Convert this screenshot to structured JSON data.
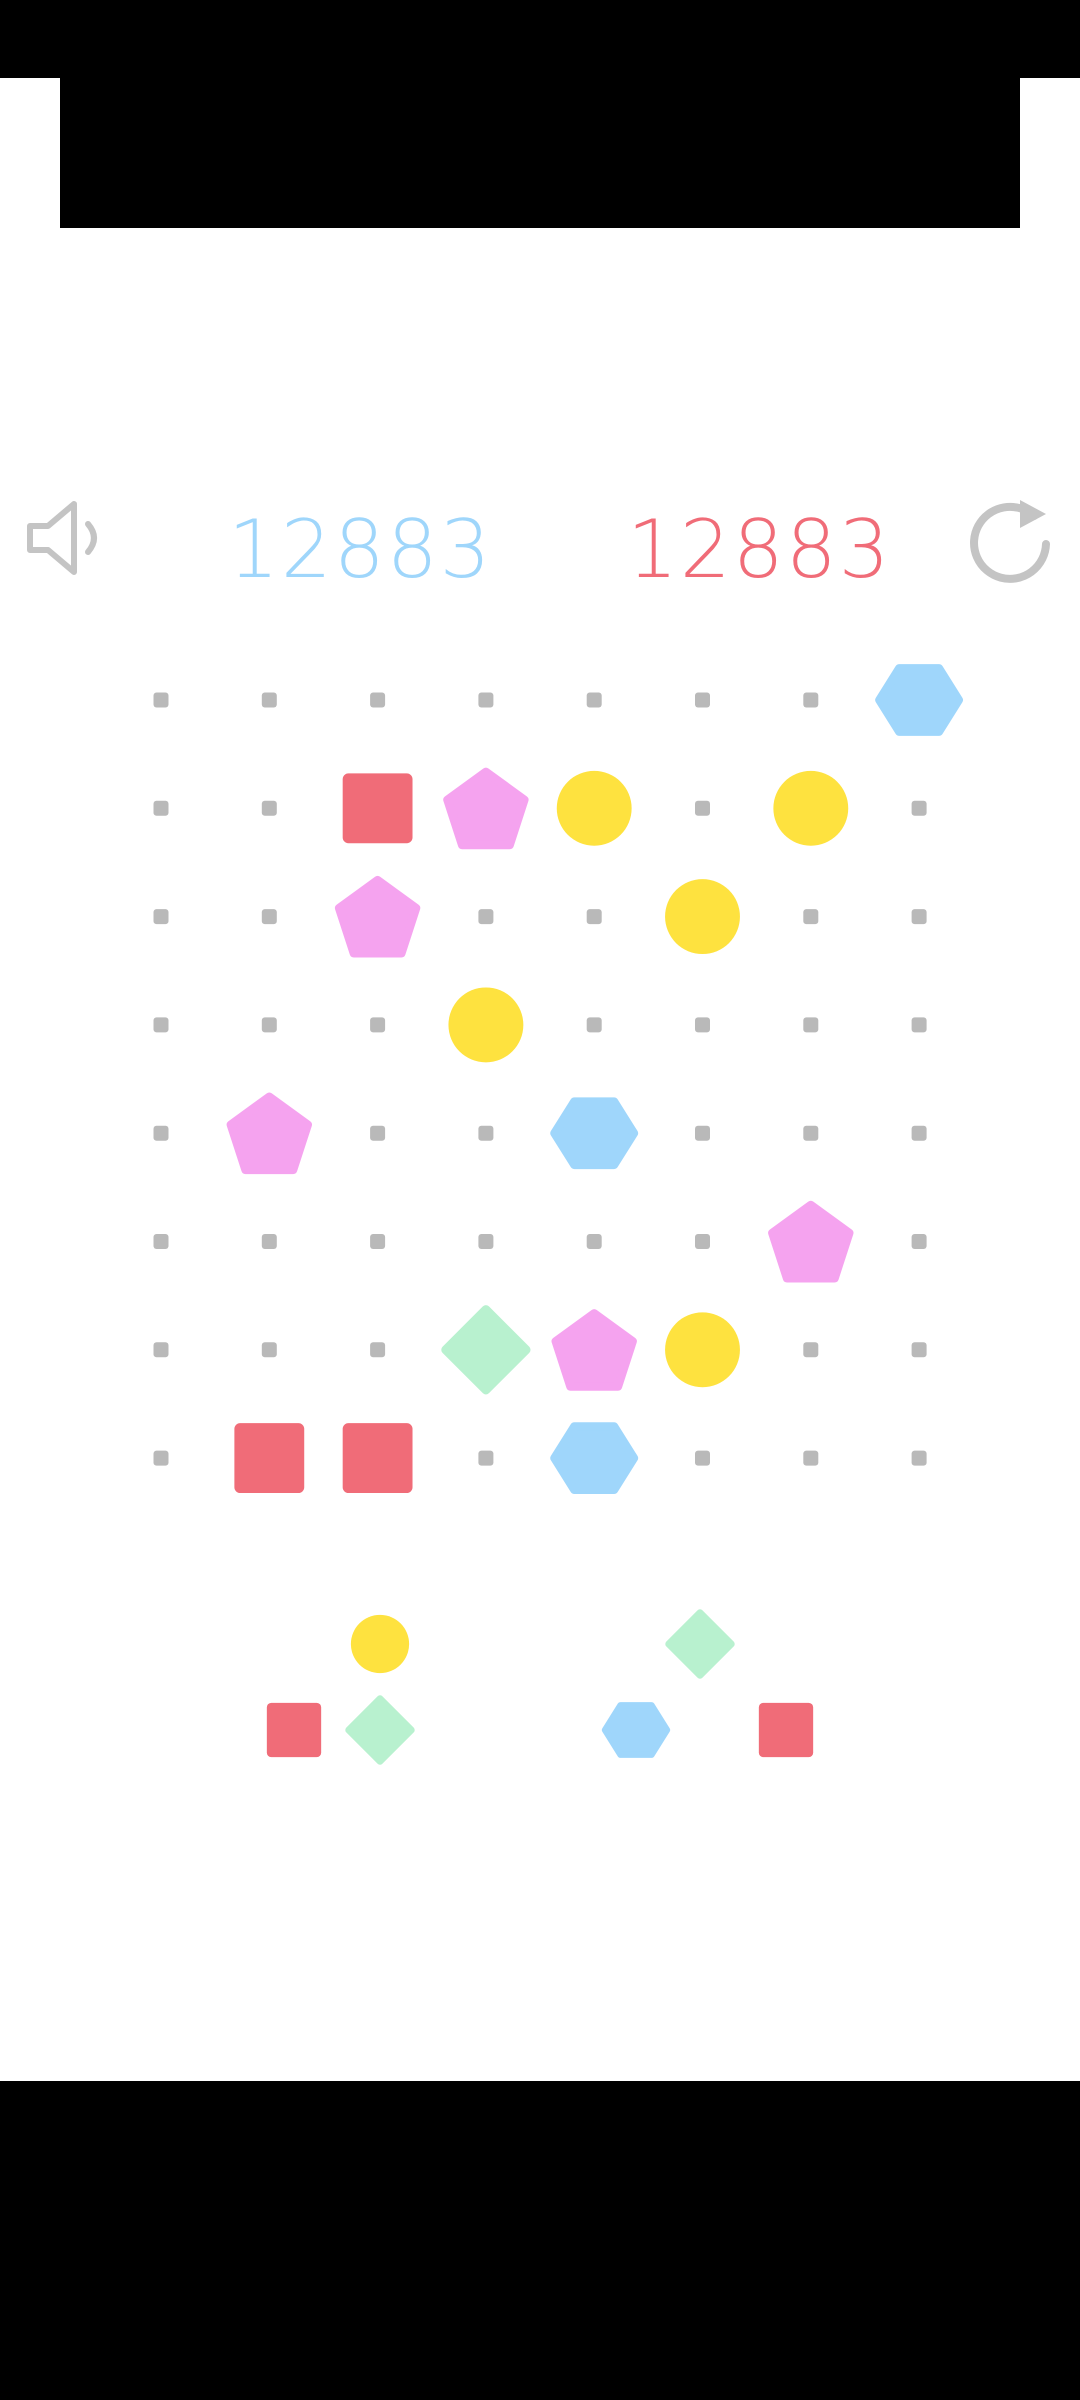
{
  "colors": {
    "dot": "#b9b9b9",
    "square": "#f06c78",
    "pentagon": "#f5a3ef",
    "circle": "#fee23f",
    "hexagon": "#9fd6fb",
    "diamond": "#b8f1cf",
    "score_current": "#9fd6fb",
    "score_best": "#f06c78",
    "icon": "#c4c4c4"
  },
  "header": {
    "current_score": "12883",
    "best_score": "12883",
    "sound_icon": "speaker-icon",
    "restart_icon": "restart-icon"
  },
  "board": {
    "rows": 8,
    "cols": 8,
    "grid": [
      [
        ".",
        ".",
        ".",
        ".",
        ".",
        ".",
        ".",
        "hexagon"
      ],
      [
        ".",
        ".",
        "square",
        "pentagon",
        "circle",
        ".",
        "circle",
        "."
      ],
      [
        ".",
        ".",
        "pentagon",
        ".",
        ".",
        "circle",
        ".",
        "."
      ],
      [
        ".",
        ".",
        ".",
        "circle",
        ".",
        ".",
        ".",
        "."
      ],
      [
        ".",
        "pentagon",
        ".",
        ".",
        "hexagon",
        ".",
        ".",
        "."
      ],
      [
        ".",
        ".",
        ".",
        ".",
        ".",
        ".",
        "pentagon",
        "."
      ],
      [
        ".",
        ".",
        ".",
        "diamond",
        "pentagon",
        "circle",
        ".",
        "."
      ],
      [
        ".",
        "square",
        "square",
        ".",
        "hexagon",
        ".",
        ".",
        "."
      ]
    ]
  },
  "next_pieces": [
    {
      "top": "circle",
      "bottom_left": "square",
      "bottom_right": "diamond"
    },
    {
      "top": "diamond",
      "bottom_left": "hexagon",
      "bottom_right": "square"
    }
  ]
}
